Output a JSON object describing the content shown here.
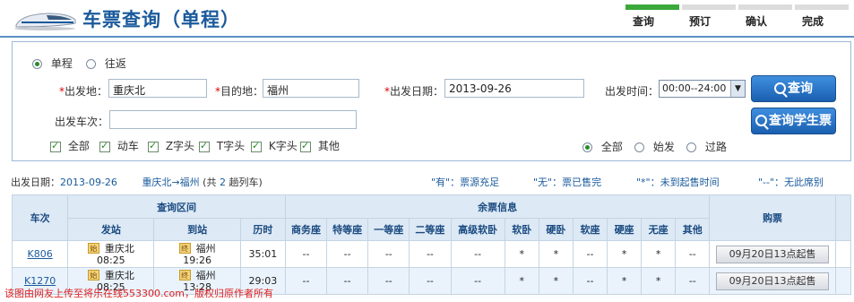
{
  "header": {
    "title": "车票查询（单程）",
    "steps": [
      {
        "label": "查询",
        "active": true
      },
      {
        "label": "预订",
        "active": false
      },
      {
        "label": "确认",
        "active": false
      },
      {
        "label": "完成",
        "active": false
      }
    ]
  },
  "search": {
    "trip_type": [
      {
        "label": "单程",
        "checked": true
      },
      {
        "label": "往返",
        "checked": false
      }
    ],
    "from_label": "出发地：",
    "from_value": "重庆北",
    "to_label": "目的地：",
    "to_value": "福州",
    "date_label": "出发日期：",
    "date_value": "2013-09-26",
    "time_label": "出发时间：",
    "time_value": "00:00--24:00",
    "train_no_label": "出发车次：",
    "train_no_value": "",
    "train_types": [
      {
        "label": "全部",
        "checked": true
      },
      {
        "label": "动车",
        "checked": true
      },
      {
        "label": "Z字头",
        "checked": true
      },
      {
        "label": "T字头",
        "checked": true
      },
      {
        "label": "K字头",
        "checked": true
      },
      {
        "label": "其他",
        "checked": true
      }
    ],
    "station_filter": [
      {
        "label": "全部",
        "checked": true
      },
      {
        "label": "始发",
        "checked": false
      },
      {
        "label": "过路",
        "checked": false
      }
    ],
    "query_button": "查询",
    "student_button": "查询学生票"
  },
  "summary": {
    "date_label": "出发日期：",
    "date": "2013-09-26",
    "route": "重庆北→福州",
    "count_prefix": "(共",
    "count": "2",
    "count_suffix": "趟列车)",
    "legend": [
      "\"有\"：票源充足",
      "\"无\"：票已售完",
      "\"*\"：未到起售时间",
      "\"--\"：无此席别"
    ]
  },
  "table": {
    "headers": {
      "train_no": "车次",
      "interval": "查询区间",
      "depart": "发站",
      "arrive": "到站",
      "duration": "历时",
      "remain": "余票信息",
      "buy": "购票",
      "seats": [
        "商务座",
        "特等座",
        "一等座",
        "二等座",
        "高级软卧",
        "软卧",
        "硬卧",
        "软座",
        "硬座",
        "无座",
        "其他"
      ]
    },
    "rows": [
      {
        "train_no": "K806",
        "from_badge": "始",
        "from_station": "重庆北",
        "from_time": "08:25",
        "to_badge": "终",
        "to_station": "福州",
        "to_time": "19:26",
        "duration": "35:01",
        "seats": [
          "--",
          "--",
          "--",
          "--",
          "--",
          "*",
          "*",
          "--",
          "*",
          "*",
          "--"
        ],
        "buy": "09月20日13点起售"
      },
      {
        "train_no": "K1270",
        "from_badge": "始",
        "from_station": "重庆北",
        "from_time": "08:25",
        "to_badge": "终",
        "to_station": "福州",
        "to_time": "13:28",
        "duration": "29:03",
        "seats": [
          "--",
          "--",
          "--",
          "--",
          "--",
          "*",
          "*",
          "--",
          "*",
          "*",
          "--"
        ],
        "buy": "09月20日13点起售"
      }
    ]
  },
  "watermark": "该图由网友上传至将乐在线553300.com，版权归原作者所有"
}
